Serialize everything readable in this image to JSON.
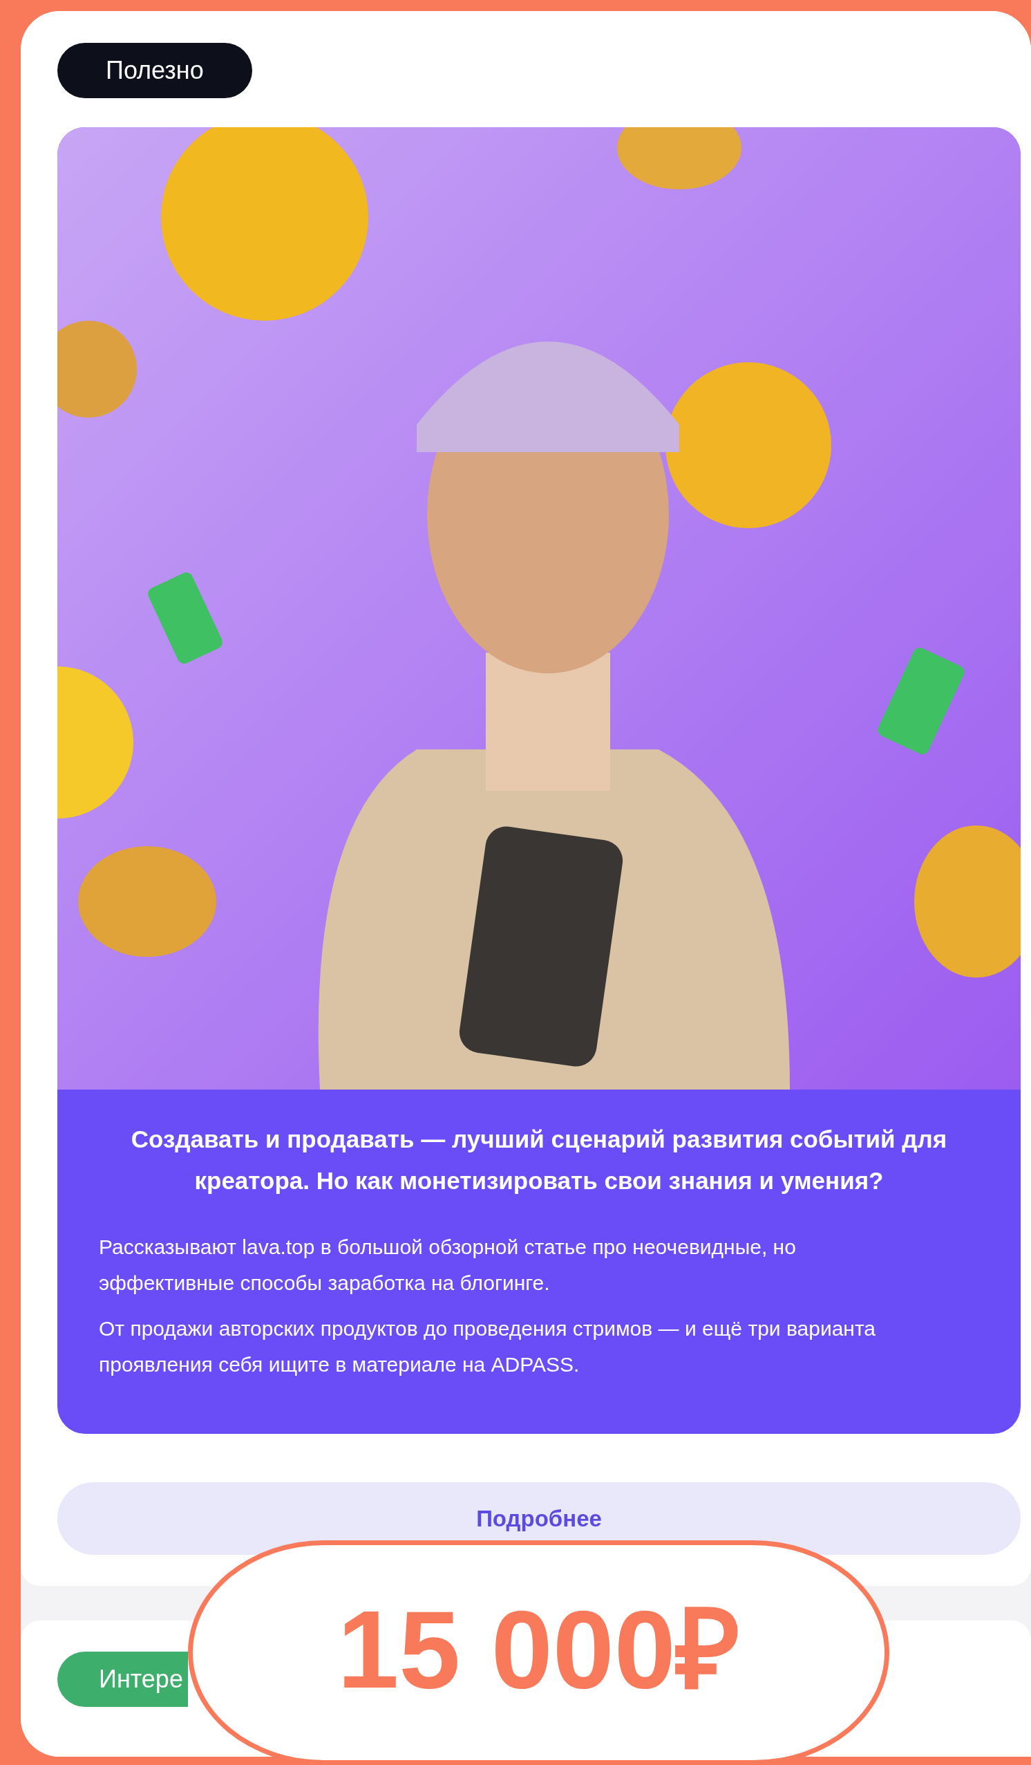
{
  "tag": {
    "label": "Полезно",
    "color": "#0d0f1a"
  },
  "post": {
    "heading": "Создавать и продавать — лучший сценарий развития событий для креатора. Но как монетизировать свои знания и умения?",
    "paragraphs": [
      "Рассказывают lava.top в большой обзорной статье про неочевидные, но эффективные способы заработка на блогинге.",
      "От продажи авторских продуктов до проведения стримов — и ещё три варианта проявления себя ищите в материале на ADPASS."
    ]
  },
  "button": {
    "label": "Подробнее"
  },
  "next_post": {
    "tag": {
      "label": "Интере",
      "color": "#3dae6b"
    }
  },
  "price_badge": {
    "label": "15 000₽"
  }
}
